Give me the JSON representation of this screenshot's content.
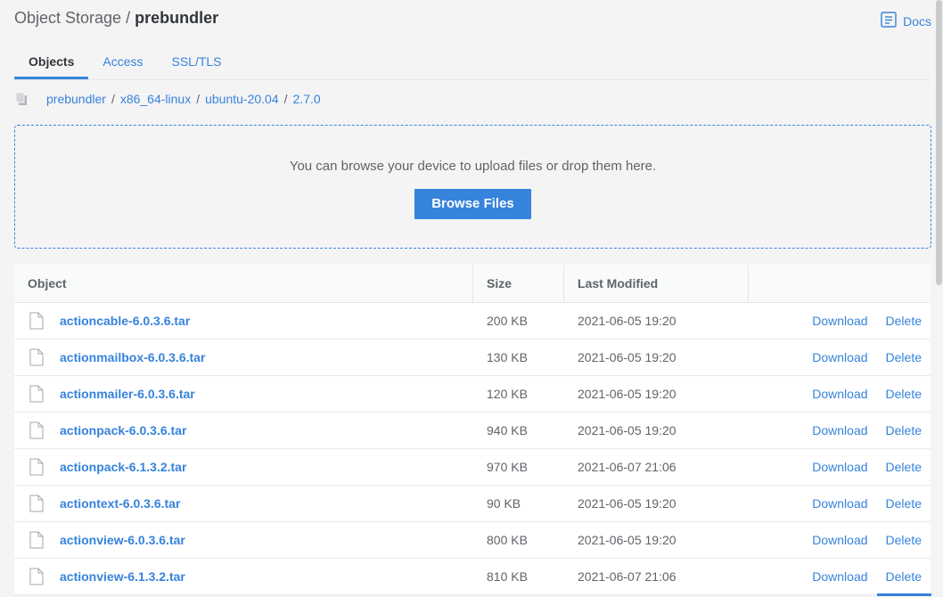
{
  "header": {
    "prefix": "Object Storage /",
    "bucket": "prebundler",
    "docs_label": "Docs"
  },
  "tabs": [
    {
      "label": "Objects",
      "active": true
    },
    {
      "label": "Access",
      "active": false
    },
    {
      "label": "SSL/TLS",
      "active": false
    }
  ],
  "breadcrumb": {
    "segments": [
      "prebundler",
      "x86_64-linux",
      "ubuntu-20.04",
      "2.7.0"
    ],
    "separator": "/"
  },
  "dropzone": {
    "message": "You can browse your device to upload files or drop them here.",
    "button": "Browse Files"
  },
  "table": {
    "headers": [
      "Object",
      "Size",
      "Last Modified",
      ""
    ],
    "download_label": "Download",
    "delete_label": "Delete",
    "rows": [
      {
        "name": "actioncable-6.0.3.6.tar",
        "size": "200 KB",
        "modified": "2021-06-05 19:20"
      },
      {
        "name": "actionmailbox-6.0.3.6.tar",
        "size": "130 KB",
        "modified": "2021-06-05 19:20"
      },
      {
        "name": "actionmailer-6.0.3.6.tar",
        "size": "120 KB",
        "modified": "2021-06-05 19:20"
      },
      {
        "name": "actionpack-6.0.3.6.tar",
        "size": "940 KB",
        "modified": "2021-06-05 19:20"
      },
      {
        "name": "actionpack-6.1.3.2.tar",
        "size": "970 KB",
        "modified": "2021-06-07 21:06"
      },
      {
        "name": "actiontext-6.0.3.6.tar",
        "size": "90 KB",
        "modified": "2021-06-05 19:20"
      },
      {
        "name": "actionview-6.0.3.6.tar",
        "size": "800 KB",
        "modified": "2021-06-05 19:20"
      },
      {
        "name": "actionview-6.1.3.2.tar",
        "size": "810 KB",
        "modified": "2021-06-07 21:06"
      }
    ]
  },
  "colors": {
    "accent": "#3683dc",
    "text": "#32363c",
    "muted": "#606469",
    "background": "#f4f4f4"
  }
}
